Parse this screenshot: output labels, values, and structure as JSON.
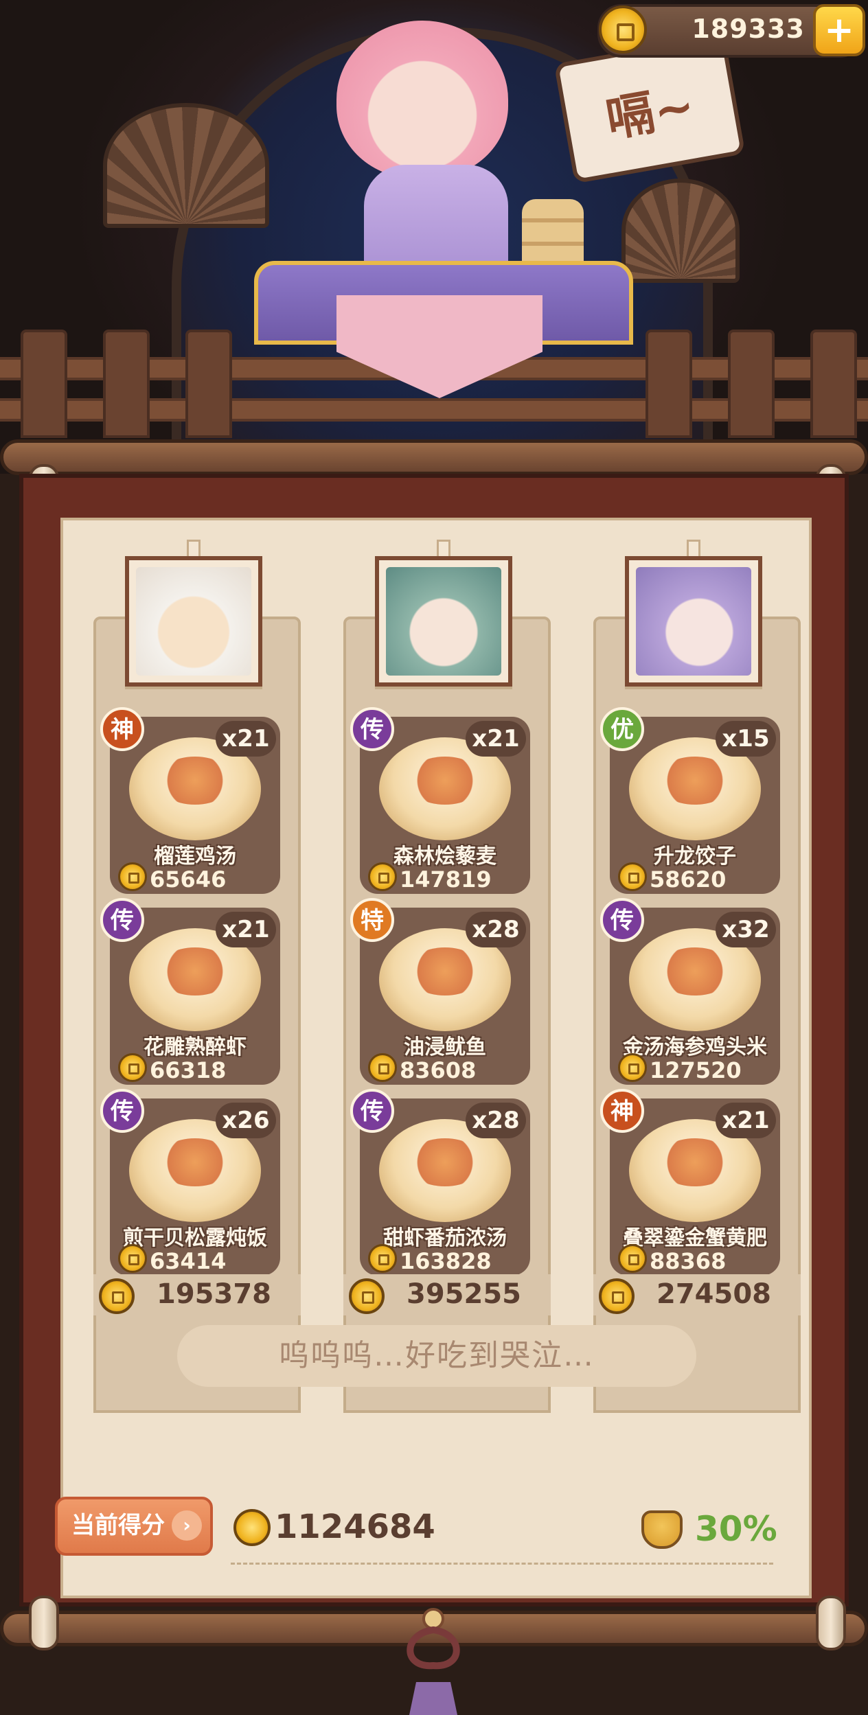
{
  "top": {
    "coins": "189333",
    "speech": "嗝~"
  },
  "board": {
    "columns": [
      {
        "total": "195378",
        "dishes": [
          {
            "badge": "神",
            "badge_color": "#c8501e",
            "name": "榴莲鸡汤",
            "qty": "x21",
            "value": "65646"
          },
          {
            "badge": "传",
            "badge_color": "#7a3c9a",
            "name": "花雕熟醉虾",
            "qty": "x21",
            "value": "66318"
          },
          {
            "badge": "传",
            "badge_color": "#7a3c9a",
            "name": "煎干贝松露炖饭",
            "qty": "x26",
            "value": "63414"
          }
        ]
      },
      {
        "total": "395255",
        "dishes": [
          {
            "badge": "传",
            "badge_color": "#7a3c9a",
            "name": "森林烩藜麦",
            "qty": "x21",
            "value": "147819"
          },
          {
            "badge": "特",
            "badge_color": "#e07a22",
            "name": "油浸鱿鱼",
            "qty": "x28",
            "value": "83608"
          },
          {
            "badge": "传",
            "badge_color": "#7a3c9a",
            "name": "甜虾番茄浓汤",
            "qty": "x28",
            "value": "163828"
          }
        ]
      },
      {
        "total": "274508",
        "dishes": [
          {
            "badge": "优",
            "badge_color": "#6aa83c",
            "name": "升龙饺子",
            "qty": "x15",
            "value": "58620"
          },
          {
            "badge": "传",
            "badge_color": "#7a3c9a",
            "name": "金汤海参鸡头米",
            "qty": "x32",
            "value": "127520"
          },
          {
            "badge": "神",
            "badge_color": "#c8501e",
            "name": "叠翠鎏金蟹黄肥",
            "qty": "x21",
            "value": "88368"
          }
        ]
      }
    ],
    "comment": "呜呜呜…好吃到哭泣…",
    "score_label": "当前得分",
    "score": "1124684",
    "bonus": "30%"
  }
}
